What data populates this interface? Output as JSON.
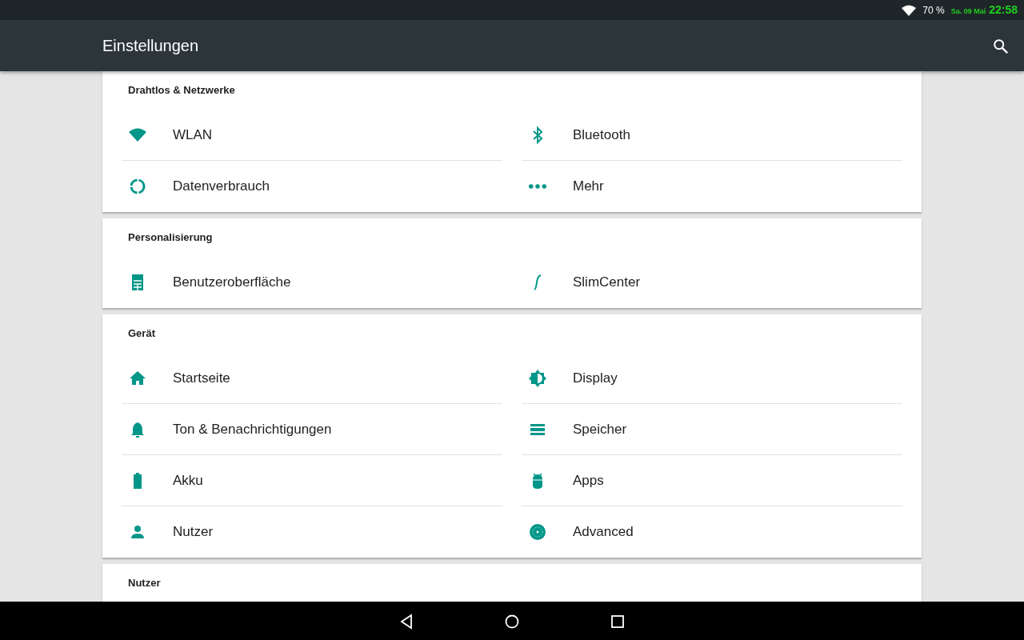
{
  "status_bar": {
    "battery": "70 %",
    "date": "Sa. 09 Mai",
    "time": "22:58"
  },
  "app_bar": {
    "title": "Einstellungen"
  },
  "sections": [
    {
      "title": "Drahtlos & Netzwerke",
      "items": [
        {
          "label": "WLAN"
        },
        {
          "label": "Bluetooth"
        },
        {
          "label": "Datenverbrauch"
        },
        {
          "label": "Mehr"
        }
      ]
    },
    {
      "title": "Personalisierung",
      "items": [
        {
          "label": "Benutzeroberfläche"
        },
        {
          "label": "SlimCenter"
        }
      ]
    },
    {
      "title": "Gerät",
      "items": [
        {
          "label": "Startseite"
        },
        {
          "label": "Display"
        },
        {
          "label": "Ton & Benachrichtigungen"
        },
        {
          "label": "Speicher"
        },
        {
          "label": "Akku"
        },
        {
          "label": "Apps"
        },
        {
          "label": "Nutzer"
        },
        {
          "label": "Advanced"
        }
      ]
    },
    {
      "title": "Nutzer"
    }
  ]
}
